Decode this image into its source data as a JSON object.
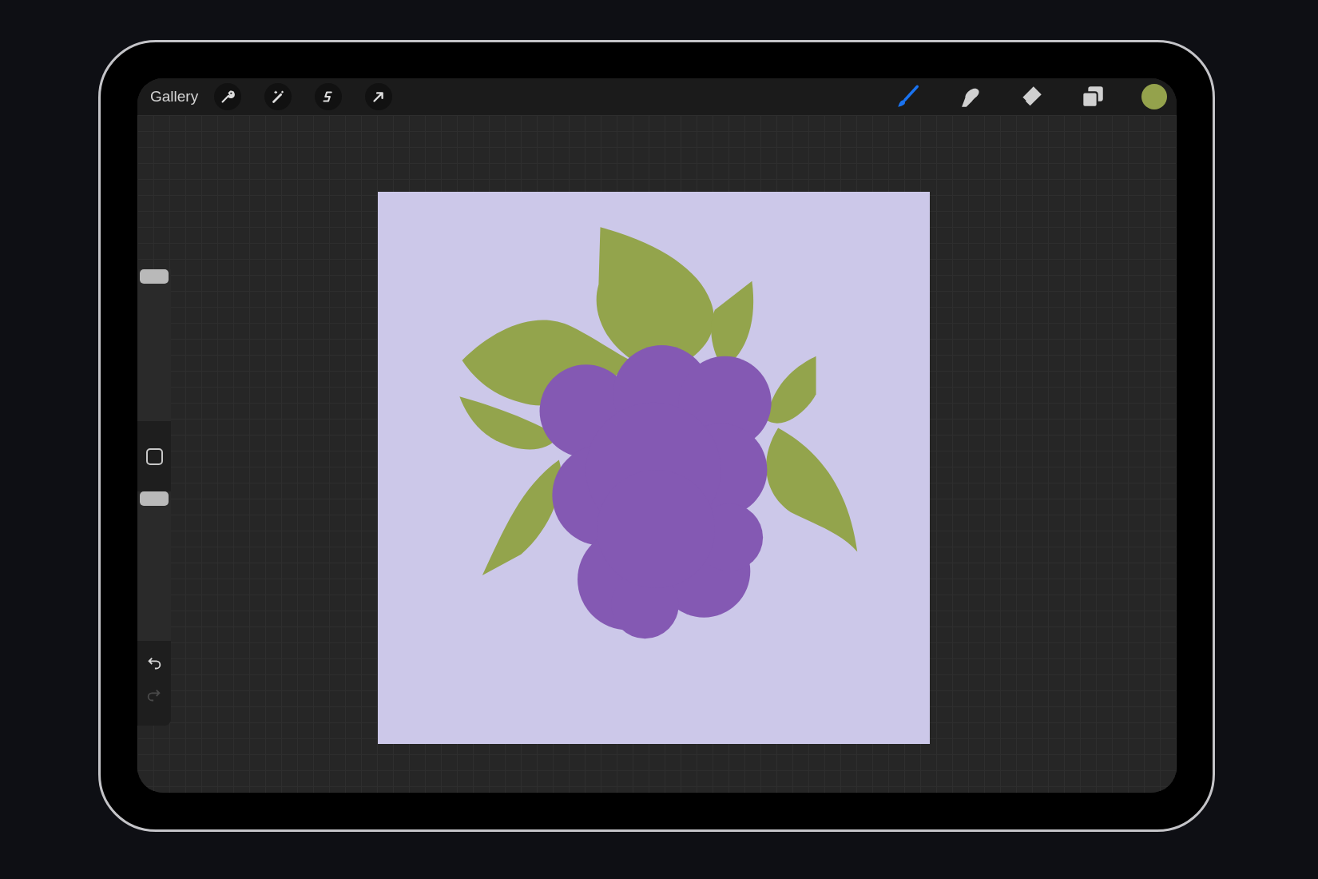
{
  "toolbar": {
    "gallery": "Gallery",
    "actions": [
      {
        "kind": "wrench"
      },
      {
        "kind": "wand"
      },
      {
        "kind": "selection"
      },
      {
        "kind": "transform"
      }
    ],
    "tools": [
      {
        "kind": "brush",
        "selected": true
      },
      {
        "kind": "smudge",
        "selected": false
      },
      {
        "kind": "eraser",
        "selected": false
      },
      {
        "kind": "layers",
        "selected": false
      }
    ],
    "swatch": {
      "color": "#94a24c"
    }
  },
  "sidebar": {
    "sliders": [
      {
        "kind": "size",
        "level": 1
      },
      {
        "kind": "opacity",
        "level": 1
      }
    ],
    "undo_disabled": false,
    "redo_disabled": true
  }
}
